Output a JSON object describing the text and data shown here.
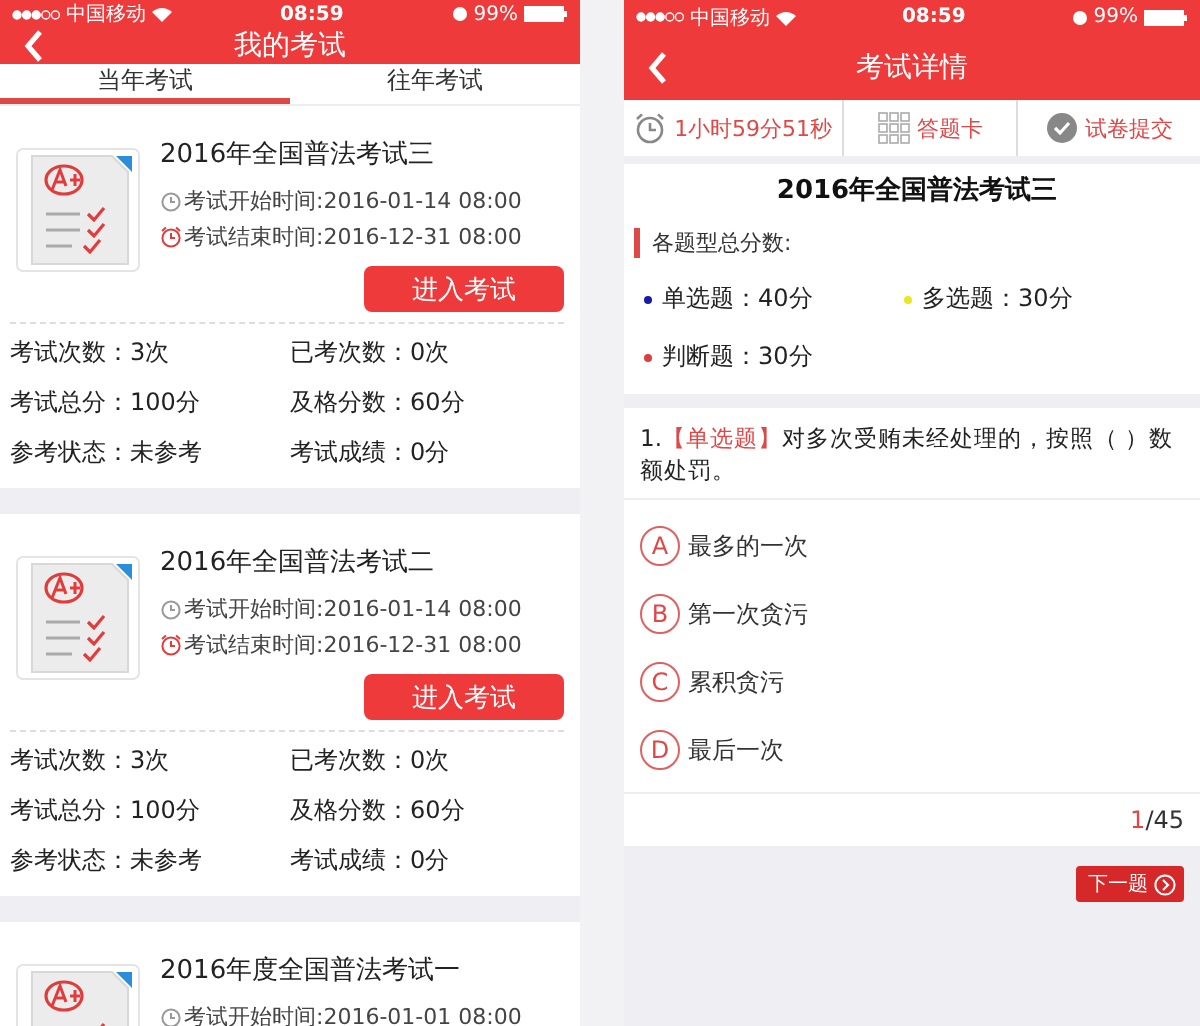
{
  "left": {
    "status": {
      "carrier": "中国移动",
      "time": "08:59",
      "battery": "99%"
    },
    "title": "我的考试",
    "tabs": [
      {
        "label": "当年考试",
        "selected": true
      },
      {
        "label": "往年考试",
        "selected": false
      }
    ],
    "exams": [
      {
        "title": "2016年全国普法考试三",
        "start": "考试开始时间:2016-01-14 08:00",
        "end": "考试结束时间:2016-12-31 08:00",
        "button": "进入考试",
        "stats": [
          "考试次数：3次",
          "已考次数：0次",
          "考试总分：100分",
          "及格分数：60分",
          "参考状态：未参考",
          "考试成绩：0分"
        ]
      },
      {
        "title": "2016年全国普法考试二",
        "start": "考试开始时间:2016-01-14 08:00",
        "end": "考试结束时间:2016-12-31 08:00",
        "button": "进入考试",
        "stats": [
          "考试次数：3次",
          "已考次数：0次",
          "考试总分：100分",
          "及格分数：60分",
          "参考状态：未参考",
          "考试成绩：0分"
        ]
      },
      {
        "title": "2016年度全国普法考试一",
        "start": "考试开始时间:2016-01-01 08:00"
      }
    ]
  },
  "right": {
    "status": {
      "carrier": "中国移动",
      "time": "08:59",
      "battery": "99%"
    },
    "title": "考试详情",
    "toolbar": {
      "timer": "1小时59分51秒",
      "answer_card": "答题卡",
      "submit": "试卷提交"
    },
    "exam_title": "2016年全国普法考试三",
    "section_label": "各题型总分数:",
    "score_types": [
      {
        "label": "单选题：40分",
        "color": "#1a1aa8"
      },
      {
        "label": "多选题：30分",
        "color": "#e8e820"
      },
      {
        "label": "判断题：30分",
        "color": "#e03c3c"
      }
    ],
    "question": {
      "number": "1.",
      "type": "【单选题】",
      "text": "对多次受贿未经处理的，按照（ ）数额处罚。"
    },
    "options": [
      {
        "letter": "A",
        "text": "最多的一次"
      },
      {
        "letter": "B",
        "text": "第一次贪污"
      },
      {
        "letter": "C",
        "text": "累积贪污"
      },
      {
        "letter": "D",
        "text": "最后一次"
      }
    ],
    "page": {
      "current": "1",
      "total": "/45"
    },
    "next": "下一题"
  }
}
